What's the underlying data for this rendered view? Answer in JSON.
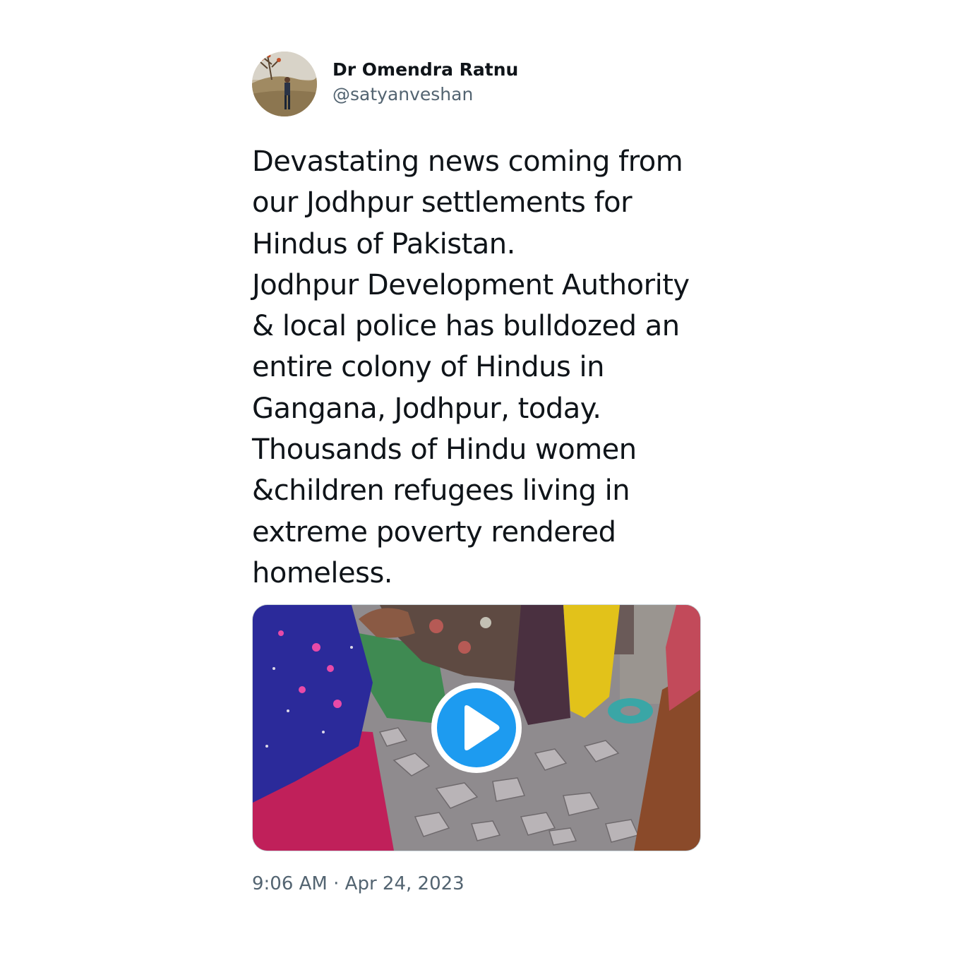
{
  "author": {
    "display_name": "Dr Omendra Ratnu",
    "handle": "@satyanveshan",
    "avatar_icon": "profile-photo"
  },
  "tweet": {
    "text": "Devastating news coming from\nour Jodhpur settlements for\nHindus of Pakistan.\nJodhpur Development Authority\n& local police has bulldozed an\nentire colony of Hindus in\nGangana, Jodhpur, today.\nThousands of Hindu women\n&children refugees living in\nextreme poverty rendered\nhomeless.",
    "timestamp": "9:06 AM · Apr 24, 2023"
  },
  "media": {
    "type": "video",
    "play_icon": "play-icon"
  },
  "colors": {
    "text_primary": "#0f1419",
    "text_secondary": "#536471",
    "accent": "#1d9bf0",
    "border": "#cfd9de"
  }
}
